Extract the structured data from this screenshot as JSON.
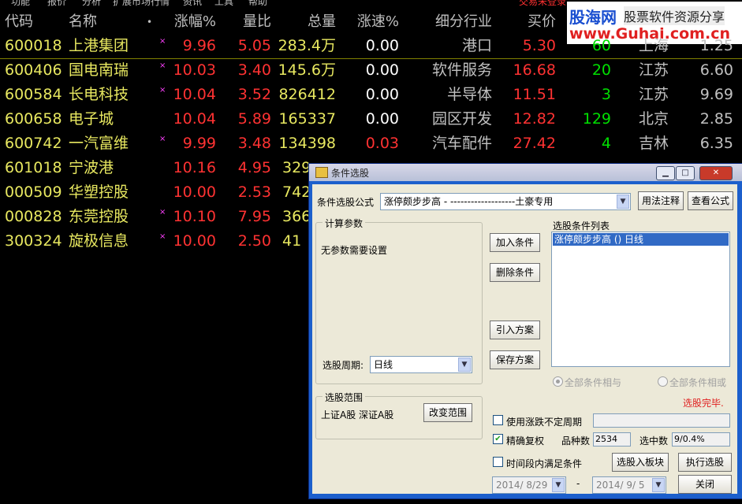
{
  "menu": {
    "items": [
      "功能",
      "报价",
      "分析",
      "扩展市场行情",
      "资讯",
      "工具",
      "帮助"
    ],
    "login": "交易未登录"
  },
  "logo": {
    "brand": "股海网",
    "slogan": "股票软件资源分享",
    "url": "www.Guhai.com.cn"
  },
  "headers": {
    "code": "代码",
    "name": "名称",
    "dot": "•",
    "chg": "涨幅%",
    "vr": "量比",
    "vol": "总量",
    "speed": "涨速%",
    "industry": "细分行业",
    "bid": "买价",
    "hidden1": "",
    "region": "",
    "last": ""
  },
  "rows": [
    {
      "code": "600018",
      "name": "上港集团",
      "mark": "×",
      "chg": "9.96",
      "vr": "5.05",
      "vol": "283.4万",
      "speed": "0.00",
      "industry": "港口",
      "bid": "5.30",
      "num": "60",
      "region": "上海",
      "last": "1.25"
    },
    {
      "code": "600406",
      "name": "国电南瑞",
      "mark": "×",
      "chg": "10.03",
      "vr": "3.40",
      "vol": "145.6万",
      "speed": "0.00",
      "industry": "软件服务",
      "bid": "16.68",
      "num": "20",
      "region": "江苏",
      "last": "6.60"
    },
    {
      "code": "600584",
      "name": "长电科技",
      "mark": "×",
      "chg": "10.04",
      "vr": "3.52",
      "vol": "826412",
      "speed": "0.00",
      "industry": "半导体",
      "bid": "11.51",
      "num": "3",
      "region": "江苏",
      "last": "9.69"
    },
    {
      "code": "600658",
      "name": "电子城",
      "mark": "",
      "chg": "10.04",
      "vr": "5.89",
      "vol": "165337",
      "speed": "0.00",
      "industry": "园区开发",
      "bid": "12.82",
      "num": "129",
      "region": "北京",
      "last": "2.85"
    },
    {
      "code": "600742",
      "name": "一汽富维",
      "mark": "×",
      "chg": "9.99",
      "vr": "3.48",
      "vol": "134398",
      "speed": "0.03",
      "industry": "汽车配件",
      "bid": "27.42",
      "num": "4",
      "region": "吉林",
      "last": "6.35"
    },
    {
      "code": "601018",
      "name": "宁波港",
      "mark": "",
      "chg": "10.16",
      "vr": "4.95",
      "vol": "329",
      "speed": "",
      "industry": "",
      "bid": "",
      "num": "",
      "region": "",
      "last": ""
    },
    {
      "code": "000509",
      "name": "华塑控股",
      "mark": "",
      "chg": "10.00",
      "vr": "2.53",
      "vol": "742",
      "speed": "",
      "industry": "",
      "bid": "",
      "num": "",
      "region": "",
      "last": ""
    },
    {
      "code": "000828",
      "name": "东莞控股",
      "mark": "×",
      "chg": "10.10",
      "vr": "7.95",
      "vol": "366",
      "speed": "",
      "industry": "",
      "bid": "",
      "num": "",
      "region": "",
      "last": ""
    },
    {
      "code": "300324",
      "name": "旋极信息",
      "mark": "×",
      "chg": "10.00",
      "vr": "2.50",
      "vol": "41",
      "speed": "",
      "industry": "",
      "bid": "",
      "num": "",
      "region": "",
      "last": ""
    }
  ],
  "dialog": {
    "title": "条件选股",
    "controls": {
      "min": "▁",
      "max": "□",
      "close": "✕"
    },
    "formula_label": "条件选股公式",
    "formula_value": "涨停颇步步高 - -------------------土豪专用",
    "btn_usage": "用法注释",
    "btn_view": "查看公式",
    "calc_group": "计算参数",
    "no_params": "无参数需要设置",
    "period_label": "选股周期:",
    "period_value": "日线",
    "btn_add": "加入条件",
    "btn_delete": "删除条件",
    "btn_import": "引入方案",
    "btn_save": "保存方案",
    "cond_list_label": "选股条件列表",
    "cond_items": [
      "涨停颇步步高 () 日线"
    ],
    "radio_and": "全部条件相与",
    "radio_or": "全部条件相或",
    "done": "选股完毕.",
    "scope_group": "选股范围",
    "scope_value": "上证A股 深证A股",
    "btn_scope": "改变范围",
    "chk_unsure": "使用涨跌不定周期",
    "chk_exact": "精确复权",
    "count_label": "品种数",
    "count_value": "2534",
    "selected_label": "选中数",
    "selected_value": "9/0.4%",
    "chk_period": "时间段内满足条件",
    "btn_to_block": "选股入板块",
    "btn_run": "执行选股",
    "date_from": "2014/ 8/29",
    "date_sep": "-",
    "date_to": "2014/ 9/ 5",
    "btn_close": "关闭"
  },
  "colors": {
    "code": "#e8e860",
    "up": "#ff3232",
    "neutral": "#ffffff",
    "accent": "#1c5fcc",
    "selection": "#316ac5"
  }
}
